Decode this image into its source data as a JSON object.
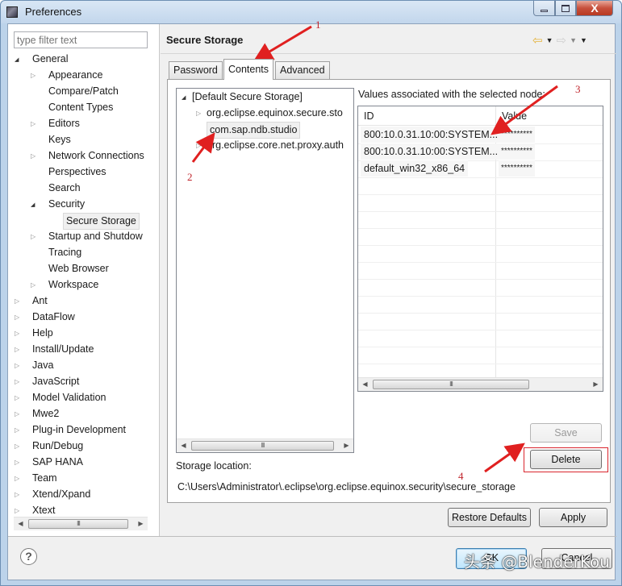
{
  "window": {
    "title": "Preferences",
    "controls": {
      "minimize": "minimize",
      "maximize": "maximize",
      "close": "X"
    }
  },
  "sidebar": {
    "filter_placeholder": "type filter text",
    "tree": [
      {
        "label": "General",
        "level": 0,
        "expander": "open"
      },
      {
        "label": "Appearance",
        "level": 1,
        "expander": "closed"
      },
      {
        "label": "Compare/Patch",
        "level": 1,
        "expander": "none"
      },
      {
        "label": "Content Types",
        "level": 1,
        "expander": "none"
      },
      {
        "label": "Editors",
        "level": 1,
        "expander": "closed"
      },
      {
        "label": "Keys",
        "level": 1,
        "expander": "none"
      },
      {
        "label": "Network Connections",
        "level": 1,
        "expander": "closed"
      },
      {
        "label": "Perspectives",
        "level": 1,
        "expander": "none"
      },
      {
        "label": "Search",
        "level": 1,
        "expander": "none"
      },
      {
        "label": "Security",
        "level": 1,
        "expander": "open"
      },
      {
        "label": "Secure Storage",
        "level": 2,
        "expander": "none",
        "selected": true
      },
      {
        "label": "Startup and Shutdow",
        "level": 1,
        "expander": "closed"
      },
      {
        "label": "Tracing",
        "level": 1,
        "expander": "none"
      },
      {
        "label": "Web Browser",
        "level": 1,
        "expander": "none"
      },
      {
        "label": "Workspace",
        "level": 1,
        "expander": "closed"
      },
      {
        "label": "Ant",
        "level": 0,
        "expander": "closed"
      },
      {
        "label": "DataFlow",
        "level": 0,
        "expander": "closed"
      },
      {
        "label": "Help",
        "level": 0,
        "expander": "closed"
      },
      {
        "label": "Install/Update",
        "level": 0,
        "expander": "closed"
      },
      {
        "label": "Java",
        "level": 0,
        "expander": "closed"
      },
      {
        "label": "JavaScript",
        "level": 0,
        "expander": "closed"
      },
      {
        "label": "Model Validation",
        "level": 0,
        "expander": "closed"
      },
      {
        "label": "Mwe2",
        "level": 0,
        "expander": "closed"
      },
      {
        "label": "Plug-in Development",
        "level": 0,
        "expander": "closed"
      },
      {
        "label": "Run/Debug",
        "level": 0,
        "expander": "closed"
      },
      {
        "label": "SAP HANA",
        "level": 0,
        "expander": "closed"
      },
      {
        "label": "Team",
        "level": 0,
        "expander": "closed"
      },
      {
        "label": "Xtend/Xpand",
        "level": 0,
        "expander": "closed"
      },
      {
        "label": "Xtext",
        "level": 0,
        "expander": "closed"
      }
    ],
    "scroll_thumb_glyph": "III"
  },
  "page": {
    "title": "Secure Storage",
    "nav": {
      "back": "back",
      "forward": "forward",
      "menu": "view-menu"
    },
    "tabs": [
      {
        "label": "Password",
        "active": false
      },
      {
        "label": "Contents",
        "active": true
      },
      {
        "label": "Advanced",
        "active": false
      }
    ],
    "node_tree": [
      {
        "label": "[Default Secure Storage]",
        "level": 0,
        "expander": "open"
      },
      {
        "label": "org.eclipse.equinox.secure.sto",
        "level": 1,
        "expander": "closed"
      },
      {
        "label": "com.sap.ndb.studio",
        "level": 1,
        "expander": "none",
        "selected": true
      },
      {
        "label": "org.eclipse.core.net.proxy.auth",
        "level": 1,
        "expander": "closed"
      }
    ],
    "values_label": "Values associated with the selected node:",
    "table": {
      "columns": [
        "ID",
        "Value"
      ],
      "rows": [
        {
          "id": "800:10.0.31.10:00:SYSTEM...",
          "value": "**********"
        },
        {
          "id": "800:10.0.31.10:00:SYSTEM...",
          "value": "**********"
        },
        {
          "id": "default_win32_x86_64",
          "value": "**********"
        }
      ]
    },
    "save_label": "Save",
    "delete_label": "Delete",
    "storage_location_label": "Storage location:",
    "storage_location_path": "C:\\Users\\Administrator\\.eclipse\\org.eclipse.equinox.security\\secure_storage",
    "restore_defaults_label": "Restore Defaults",
    "apply_label": "Apply"
  },
  "footer": {
    "help": "?",
    "ok_label": "OK",
    "cancel_label": "Cancel"
  },
  "annotations": {
    "labels": [
      "1",
      "2",
      "3",
      "4"
    ],
    "arrow_color": "#e02020",
    "watermark": "头条 @BlenderKou"
  }
}
